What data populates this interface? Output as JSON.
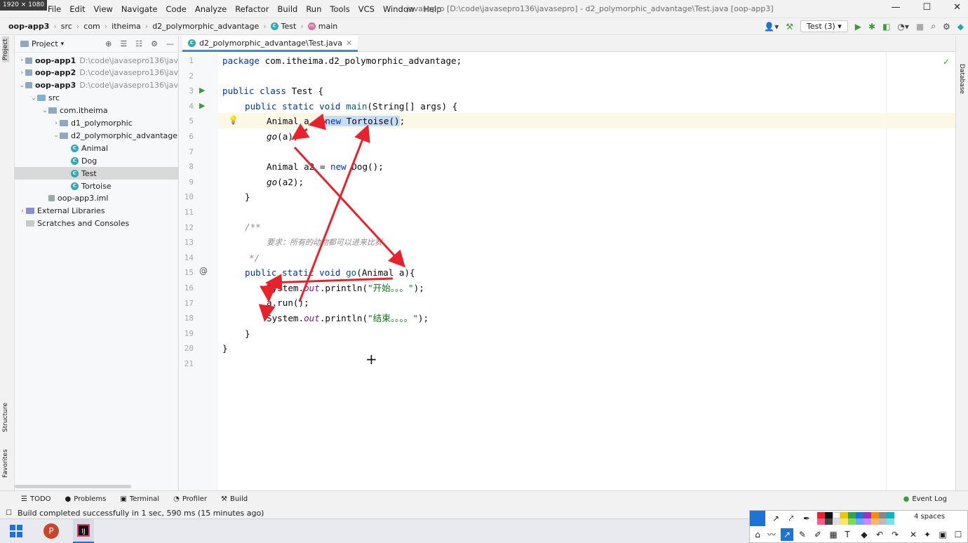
{
  "screen_badge": "1920 × 1080",
  "menu": [
    "File",
    "Edit",
    "View",
    "Navigate",
    "Code",
    "Analyze",
    "Refactor",
    "Build",
    "Run",
    "Tools",
    "VCS",
    "Window",
    "Help"
  ],
  "window_title": "javasepro [D:\\code\\javasepro136\\javasepro] - d2_polymorphic_advantage\\Test.java [oop-app3]",
  "breadcrumbs": [
    "oop-app3",
    "src",
    "com",
    "itheima",
    "d2_polymorphic_advantage",
    "Test",
    "main"
  ],
  "run_config": "Test (3)",
  "project_panel": {
    "title": "Project",
    "rows": [
      {
        "label": "oop-app1",
        "path": "D:\\code\\javasepro136\\jav",
        "bold": true,
        "depth": 0,
        "arrow": "›"
      },
      {
        "label": "oop-app2",
        "path": "D:\\code\\javasepro136\\jav",
        "bold": true,
        "depth": 0,
        "arrow": "›"
      },
      {
        "label": "oop-app3",
        "path": "D:\\code\\javasepro136\\jav",
        "bold": true,
        "depth": 0,
        "arrow": "⌄"
      },
      {
        "label": "src",
        "path": "",
        "bold": false,
        "depth": 1,
        "arrow": "⌄"
      },
      {
        "label": "com.itheima",
        "path": "",
        "bold": false,
        "depth": 2,
        "arrow": "⌄"
      },
      {
        "label": "d1_polymorphic",
        "path": "",
        "bold": false,
        "depth": 3,
        "arrow": "›"
      },
      {
        "label": "d2_polymorphic_advantage",
        "path": "",
        "bold": false,
        "depth": 3,
        "arrow": "⌄"
      },
      {
        "label": "Animal",
        "path": "",
        "bold": false,
        "depth": 4,
        "arrow": ""
      },
      {
        "label": "Dog",
        "path": "",
        "bold": false,
        "depth": 4,
        "arrow": ""
      },
      {
        "label": "Test",
        "path": "",
        "bold": false,
        "depth": 4,
        "arrow": ""
      },
      {
        "label": "Tortoise",
        "path": "",
        "bold": false,
        "depth": 4,
        "arrow": ""
      },
      {
        "label": "oop-app3.iml",
        "path": "",
        "bold": false,
        "depth": 2,
        "arrow": ""
      },
      {
        "label": "External Libraries",
        "path": "",
        "bold": false,
        "depth": 0,
        "arrow": "›"
      },
      {
        "label": "Scratches and Consoles",
        "path": "",
        "bold": false,
        "depth": 0,
        "arrow": ""
      }
    ]
  },
  "left_strip": {
    "project": "Project",
    "structure": "Structure",
    "favorites": "Favorites"
  },
  "right_strip": {
    "database": "Database"
  },
  "editor_tab": "d2_polymorphic_advantage\\Test.java",
  "code": {
    "lines": [
      "1",
      "2",
      "3",
      "4",
      "5",
      "6",
      "7",
      "8",
      "9",
      "10",
      "11",
      "12",
      "13",
      "14",
      "15",
      "16",
      "17",
      "18",
      "19",
      "20",
      "21"
    ],
    "l1_kw": "package",
    "l1_rest": " com.itheima.d2_polymorphic_advantage;",
    "l3_kw": "public class",
    "l3_rest": " Test {",
    "l4_kw": "public static void",
    "l4_fn": " main",
    "l4_rest": "(String[] args) {",
    "l5_a": "Animal a = ",
    "l5_kw": "new",
    "l5_sel": " Tortoise()",
    "l5_end": ";",
    "l6_fn": "go",
    "l6_rest": "(a);",
    "l8_a": "Animal a2 = ",
    "l8_kw": "new",
    "l8_rest": " Dog();",
    "l9_fn": "go",
    "l9_rest": "(a2);",
    "l10": "}",
    "l12": "/**",
    "l13": "要求：所有的动物都可以进来比赛",
    "l14": "*/",
    "l15_kw": "public static void",
    "l15_fn": " go",
    "l15_rest": "(Animal a){",
    "l16_a": "System.",
    "l16_out": "out",
    "l16_b": ".println(",
    "l16_str": "\"开始。。。\"",
    "l16_end": ");",
    "l17": "a.run();",
    "l18_a": "System.",
    "l18_out": "out",
    "l18_b": ".println(",
    "l18_str": "\"结束。。。。\"",
    "l18_end": ");",
    "l19": "}",
    "l20": "}"
  },
  "bottom_tabs": [
    "TODO",
    "Problems",
    "Terminal",
    "Profiler",
    "Build"
  ],
  "event_log": "Event Log",
  "status": "Build completed successfully in 1 sec, 590 ms (15 minutes ago)",
  "indent": "4 spaces",
  "accent_color": "#4a88c7",
  "annotation_color": "#e8212b"
}
